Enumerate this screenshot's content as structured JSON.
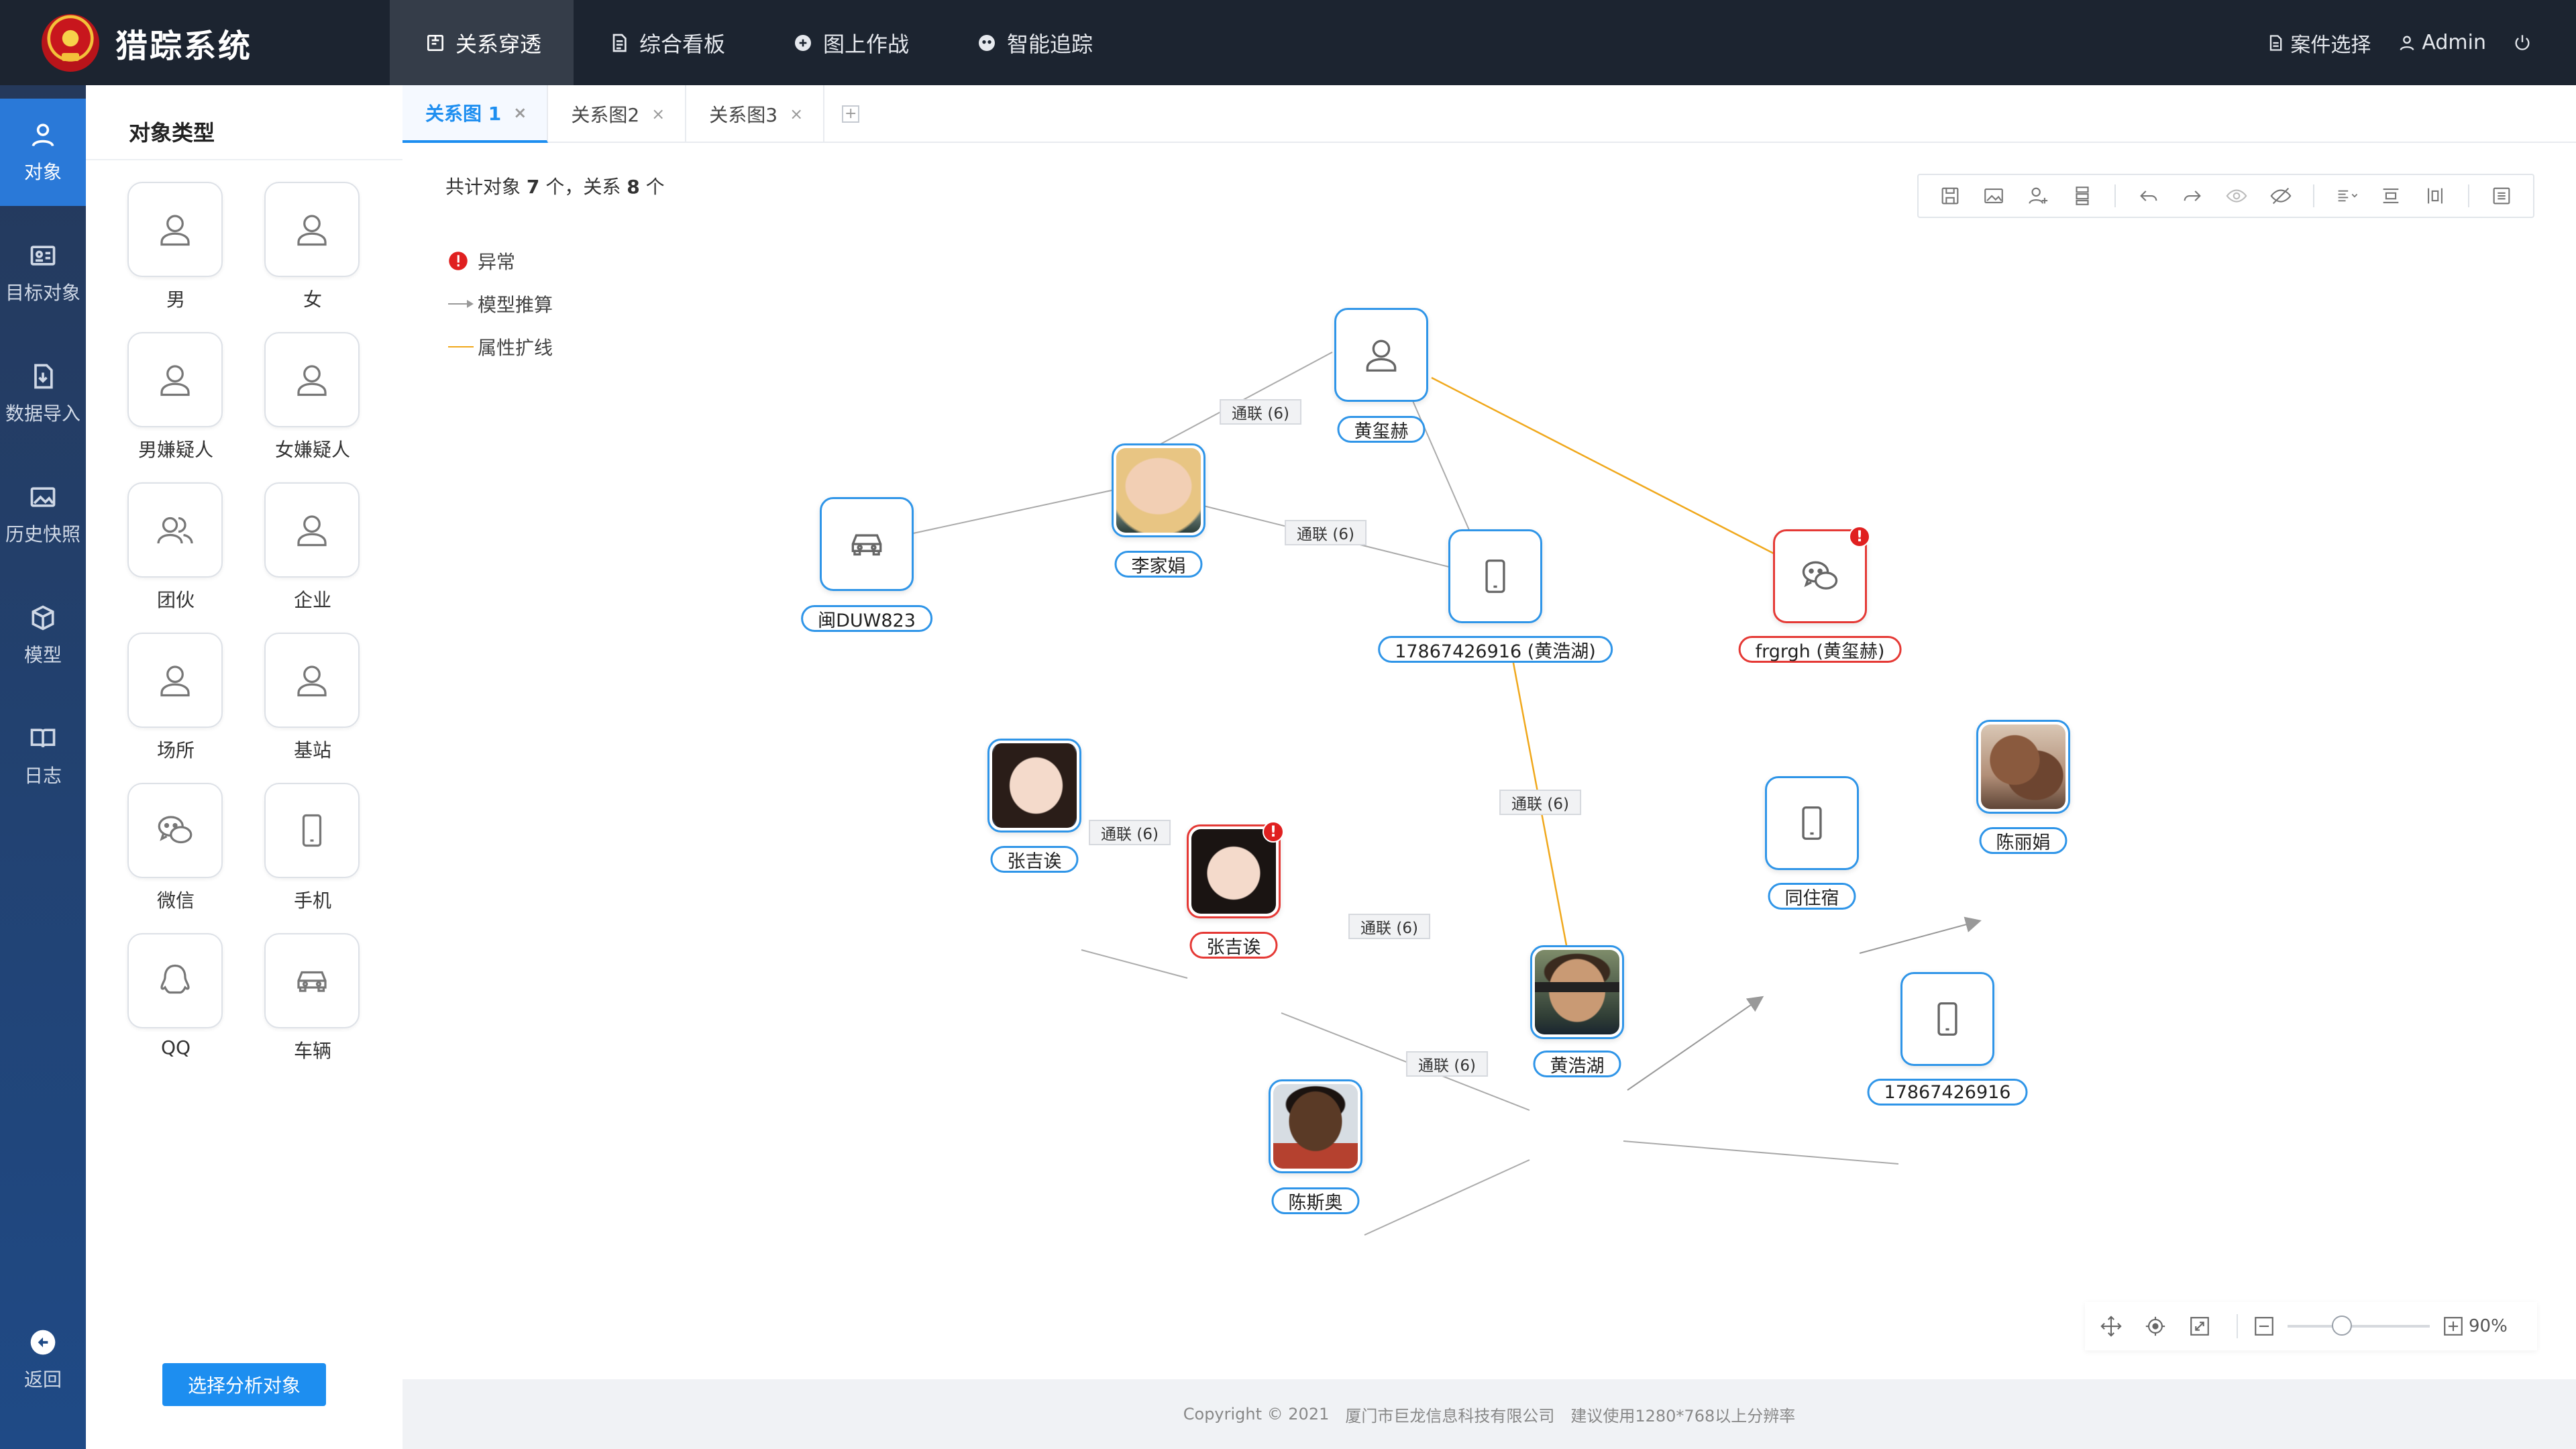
{
  "app": {
    "title": "猎踪系统"
  },
  "nav": [
    {
      "label": "关系穿透",
      "icon": "relation-icon",
      "active": true
    },
    {
      "label": "综合看板",
      "icon": "document-icon",
      "active": false
    },
    {
      "label": "图上作战",
      "icon": "map-battle-icon",
      "active": false
    },
    {
      "label": "智能追踪",
      "icon": "tracking-icon",
      "active": false
    }
  ],
  "top_right": {
    "case_select": "案件选择",
    "user": "Admin"
  },
  "rail": [
    {
      "label": "对象",
      "active": true
    },
    {
      "label": "目标对象",
      "active": false
    },
    {
      "label": "数据导入",
      "active": false
    },
    {
      "label": "历史快照",
      "active": false
    },
    {
      "label": "模型",
      "active": false
    },
    {
      "label": "日志",
      "active": false
    },
    {
      "label": "返回",
      "active": false
    }
  ],
  "panel": {
    "title": "对象类型",
    "items": [
      {
        "label": "男",
        "icon": "person-icon"
      },
      {
        "label": "女",
        "icon": "person-icon"
      },
      {
        "label": "男嫌疑人",
        "icon": "person-icon"
      },
      {
        "label": "女嫌疑人",
        "icon": "person-icon"
      },
      {
        "label": "团伙",
        "icon": "group-icon"
      },
      {
        "label": "企业",
        "icon": "person-icon"
      },
      {
        "label": "场所",
        "icon": "person-icon"
      },
      {
        "label": "基站",
        "icon": "person-icon"
      },
      {
        "label": "微信",
        "icon": "wechat-icon"
      },
      {
        "label": "手机",
        "icon": "phone-icon"
      },
      {
        "label": "QQ",
        "icon": "qq-icon"
      },
      {
        "label": "车辆",
        "icon": "car-icon"
      }
    ],
    "select_button": "选择分析对象"
  },
  "tabs": [
    {
      "label": "关系图 1",
      "active": true
    },
    {
      "label": "关系图2",
      "active": false
    },
    {
      "label": "关系图3",
      "active": false
    }
  ],
  "summary": {
    "prefix": "共计对象",
    "objects": "7",
    "mid": "个，关系",
    "relations": "8",
    "suffix": "个"
  },
  "legend": [
    {
      "label": "异常",
      "symbol": "alert"
    },
    {
      "label": "模型推算",
      "symbol": "arrow"
    },
    {
      "label": "属性扩线",
      "symbol": "orange-line"
    }
  ],
  "graph": {
    "nodes": {
      "huangxihe": {
        "label": "黄玺赫",
        "kind": "person"
      },
      "lijiajuan": {
        "label": "李家娟",
        "kind": "photo"
      },
      "car": {
        "label": "闽DUW823",
        "kind": "car"
      },
      "phone1": {
        "label": "17867426916 (黄浩湖)",
        "kind": "phone"
      },
      "wechat": {
        "label": "frgrgh (黄玺赫)",
        "kind": "wechat",
        "alert": true
      },
      "zhangjiyi1": {
        "label": "张吉诶",
        "kind": "photo"
      },
      "zhangjiyi2": {
        "label": "张吉诶",
        "kind": "photo",
        "alert": true
      },
      "huanghaohu": {
        "label": "黄浩湖",
        "kind": "photo"
      },
      "tongzhusu": {
        "label": "同住宿",
        "kind": "phone"
      },
      "chenlijuan": {
        "label": "陈丽娟",
        "kind": "photo"
      },
      "phone2": {
        "label": "17867426916",
        "kind": "phone"
      },
      "chensiao": {
        "label": "陈斯奥",
        "kind": "photo"
      }
    },
    "edge_labels": {
      "e1": "通联 (6)",
      "e2": "通联 (6)",
      "e3": "通联 (6)",
      "e4": "通联 (6)",
      "e5": "通联 (6)",
      "e6": "通联 (6)"
    }
  },
  "zoom": {
    "value": "90%"
  },
  "footer": {
    "copyright": "Copyright © 2021",
    "company": "厦门市巨龙信息科技有限公司",
    "note": "建议使用1280*768以上分辨率"
  },
  "colors": {
    "topbar": "#1c2430",
    "accent": "#1d8ef0",
    "node_border": "#2f95e8",
    "alert": "#e53935",
    "attr_line": "#f0a81c"
  }
}
